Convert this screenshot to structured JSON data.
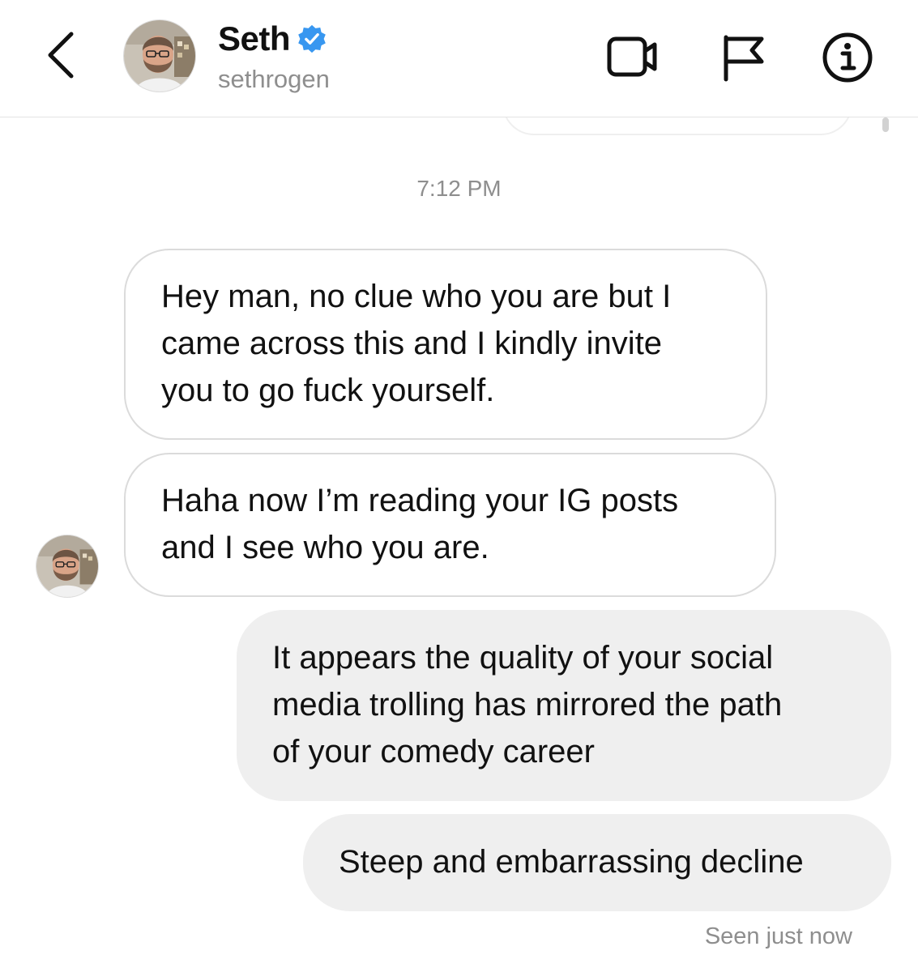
{
  "header": {
    "display_name": "Seth",
    "username": "sethrogen",
    "icons": {
      "back": "chevron-left-icon",
      "verified": "verified-badge-icon",
      "video": "video-camera-icon",
      "flag": "flag-icon",
      "info": "info-icon"
    },
    "colors": {
      "verified": "#3897f0",
      "secondary_text": "#8e8e8e"
    }
  },
  "thread": {
    "timestamp": "7:12 PM",
    "messages": [
      {
        "direction": "incoming",
        "lines": [
          "Hey man, no clue who you are but I",
          "came across this and I kindly invite",
          "you to go fuck yourself."
        ]
      },
      {
        "direction": "incoming",
        "lines": [
          "Haha now I’m reading your IG posts",
          "and I see who you are."
        ]
      },
      {
        "direction": "outgoing",
        "lines": [
          "It appears the quality of your social",
          "media trolling has mirrored the path",
          "of your comedy career"
        ]
      },
      {
        "direction": "outgoing",
        "lines": [
          "Steep and embarrassing decline"
        ]
      }
    ],
    "seen_status": "Seen just now",
    "colors": {
      "outgoing_bubble": "#efefef",
      "incoming_border": "#dbdbdb"
    }
  }
}
